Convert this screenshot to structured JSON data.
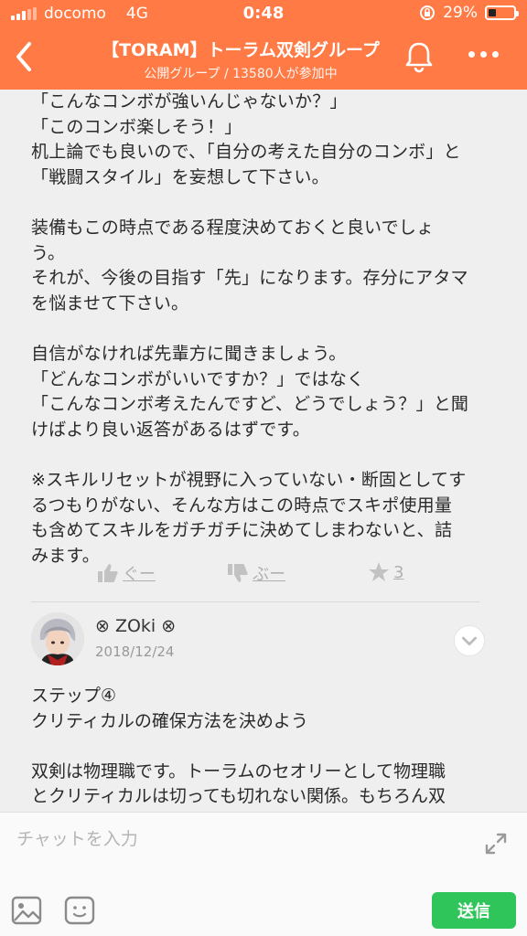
{
  "status_bar": {
    "carrier": "docomo",
    "network": "4G",
    "time": "0:48",
    "battery": "29%",
    "battery_level": 0.29
  },
  "header": {
    "title": "【TORAM】トーラム双剣グループ",
    "subtitle": "公開グループ / 13580人が参加中"
  },
  "message": {
    "paragraphs": [
      "「こんなコンボが強いんじゃないか？」\n「このコンボ楽しそう！」\n机上論でも良いので、「自分の考えた自分のコンボ」と\n「戦闘スタイル」を妄想して下さい。",
      "装備もこの時点である程度決めておくと良いでしょ\nう。\nそれが、今後の目指す「先」になります。存分にアタマ\nを悩ませて下さい。",
      "自信がなければ先輩方に聞きましょう。\n「どんなコンボがいいですか？」ではなく\n「こんなコンボ考えたんですど、どうでしょう？」と聞\nけばより良い返答があるはずです。",
      "※スキルリセットが視野に入っていない・断固としてす\nるつもりがない、そんな方はこの時点でスキポ使用量\nも含めてスキルをガチガチに決めてしまわないと、詰\nみます。"
    ],
    "reactions": {
      "like_label": "ぐー",
      "dislike_label": "ぶー",
      "star_count": "3"
    }
  },
  "next_post": {
    "author": "⊗ ZOki ⊗",
    "date": "2018/12/24",
    "paragraphs": [
      "ステップ④\nクリティカルの確保方法を決めよう",
      "双剣は物理職です。トーラムのセオリーとして物理職\nとクリティカルは切っても切れない関係。もちろん双\n剣でもこれは重要になってきます。"
    ]
  },
  "composer": {
    "placeholder": "チャットを入力",
    "send_label": "送信"
  },
  "colors": {
    "accent": "#ff7a45",
    "send": "#2fc55a"
  },
  "icons": [
    "back-icon",
    "bell-icon",
    "more-icon",
    "thumbs-up-icon",
    "thumbs-down-icon",
    "star-icon",
    "chevron-down-icon",
    "expand-icon",
    "image-icon",
    "sticker-icon"
  ]
}
